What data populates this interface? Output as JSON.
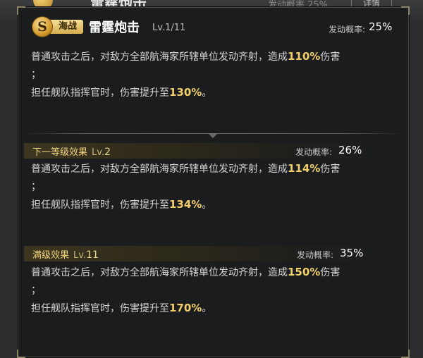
{
  "background": {
    "title": "雷霆炮击",
    "rate": "发动概率 25%",
    "button": "详情"
  },
  "header": {
    "s_badge": "S",
    "tag": "海战",
    "skill_name": "雷霆炮击",
    "level": "Lv.1/11",
    "rate_label": "发动概率:",
    "rate_value": "25%"
  },
  "current": {
    "line1_pre": "普通攻击之后，对敌方全部航海家所辖单位发动齐射，造成",
    "line1_val": "110%",
    "line1_post": "伤害",
    "line2": "；",
    "line3_pre": "担任舰队指挥官时，伤害提升至",
    "line3_val": "130%",
    "line3_post": "。"
  },
  "next": {
    "title": "下一等级效果",
    "lv_prefix": "Lv.",
    "lv_num": "2",
    "rate_label": "发动概率:",
    "rate_value": "26%",
    "line1_pre": "普通攻击之后，对敌方全部航海家所辖单位发动齐射，造成",
    "line1_val": "114%",
    "line1_post": "伤害",
    "line2": "；",
    "line3_pre": "担任舰队指挥官时，伤害提升至",
    "line3_val": "134%",
    "line3_post": "。"
  },
  "max": {
    "title": "满级效果",
    "lv_prefix": "Lv.",
    "lv_num": "11",
    "rate_label": "发动概率:",
    "rate_value": "35%",
    "line1_pre": "普通攻击之后，对敌方全部航海家所辖单位发动齐射，造成",
    "line1_val": "150%",
    "line1_post": "伤害",
    "line2": "；",
    "line3_pre": "担任舰队指挥官时，伤害提升至",
    "line3_val": "170%",
    "line3_post": "。"
  }
}
